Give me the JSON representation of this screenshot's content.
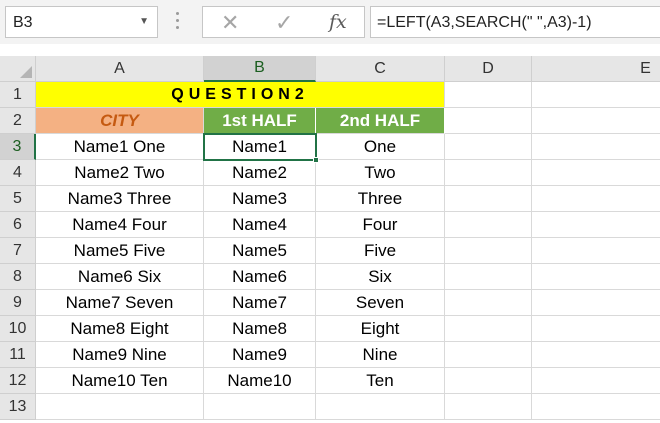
{
  "formula_bar": {
    "name_box": "B3",
    "cancel_icon": "✕",
    "enter_icon": "✓",
    "fx_label": "fx",
    "formula": "=LEFT(A3,SEARCH(\" \",A3)-1)"
  },
  "sheet": {
    "column_headers": [
      "A",
      "B",
      "C",
      "D",
      "E"
    ],
    "row_numbers": [
      "1",
      "2",
      "3",
      "4",
      "5",
      "6",
      "7",
      "8",
      "9",
      "10",
      "11",
      "12",
      "13"
    ],
    "selected_cell": "B3",
    "title": "QUESTION2",
    "headers": {
      "city": "CITY",
      "first_half": "1st HALF",
      "second_half": "2nd HALF"
    },
    "rows": [
      {
        "city": "Name1 One",
        "first": "Name1",
        "second": "One"
      },
      {
        "city": "Name2 Two",
        "first": "Name2",
        "second": "Two"
      },
      {
        "city": "Name3 Three",
        "first": "Name3",
        "second": "Three"
      },
      {
        "city": "Name4 Four",
        "first": "Name4",
        "second": "Four"
      },
      {
        "city": "Name5 Five",
        "first": "Name5",
        "second": "Five"
      },
      {
        "city": "Name6 Six",
        "first": "Name6",
        "second": "Six"
      },
      {
        "city": "Name7 Seven",
        "first": "Name7",
        "second": "Seven"
      },
      {
        "city": "Name8 Eight",
        "first": "Name8",
        "second": "Eight"
      },
      {
        "city": "Name9 Nine",
        "first": "Name9",
        "second": "Nine"
      },
      {
        "city": "Name10 Ten",
        "first": "Name10",
        "second": "Ten"
      }
    ],
    "colors": {
      "title_fill": "#ffff00",
      "city_fill": "#f4b183",
      "city_text": "#c55a11",
      "half_fill": "#70ad47",
      "selection": "#217346"
    }
  }
}
